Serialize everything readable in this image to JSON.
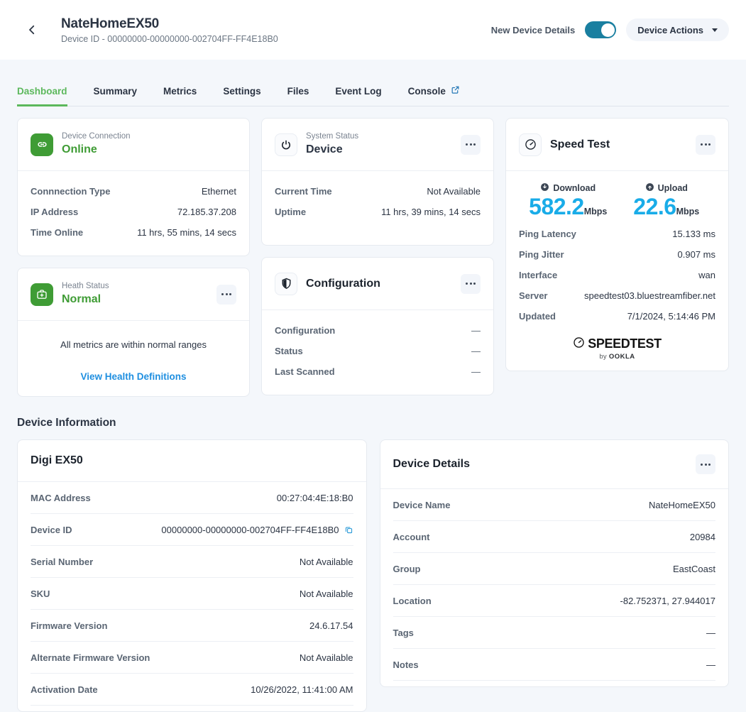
{
  "header": {
    "back_icon": "chevron-left-icon",
    "title": "NateHomeEX50",
    "subtitle": "Device ID - 00000000-00000000-002704FF-FF4E18B0",
    "toggle_label": "New Device Details",
    "toggle_state": "on",
    "toggle_color": "#1a7fa0",
    "actions_button": "Device Actions"
  },
  "tabs": [
    {
      "label": "Dashboard",
      "active": true
    },
    {
      "label": "Summary",
      "active": false
    },
    {
      "label": "Metrics",
      "active": false
    },
    {
      "label": "Settings",
      "active": false
    },
    {
      "label": "Files",
      "active": false
    },
    {
      "label": "Event Log",
      "active": false
    },
    {
      "label": "Console",
      "active": false,
      "icon": "external-link-icon"
    }
  ],
  "accent_colors": {
    "tab_active": "#5cb85c",
    "status_green": "#3f9c35",
    "speed_blue": "#19ace8",
    "link_blue": "#1f8fe0"
  },
  "device_connection": {
    "icon": "link-icon",
    "eyebrow": "Device Connection",
    "status": "Online",
    "rows": [
      {
        "key": "Connnection Type",
        "value": "Ethernet"
      },
      {
        "key": "IP Address",
        "value": "72.185.37.208"
      },
      {
        "key": "Time Online",
        "value": "11 hrs, 55 mins, 14 secs"
      }
    ]
  },
  "health_status": {
    "icon": "first-aid-kit-icon",
    "eyebrow": "Heath Status",
    "status": "Normal",
    "message": "All metrics are within normal ranges",
    "link": "View Health Definitions",
    "menu_icon": "kebab-menu-icon"
  },
  "system_status": {
    "icon": "power-cycle-icon",
    "eyebrow": "System Status",
    "status": "Device",
    "menu_icon": "kebab-menu-icon",
    "rows": [
      {
        "key": "Current Time",
        "value": "Not Available"
      },
      {
        "key": "Uptime",
        "value": "11 hrs, 39 mins, 14 secs"
      }
    ]
  },
  "configuration": {
    "icon": "shield-icon",
    "title": "Configuration",
    "menu_icon": "kebab-menu-icon",
    "rows": [
      {
        "key": "Configuration",
        "value": "—"
      },
      {
        "key": "Status",
        "value": "—"
      },
      {
        "key": "Last Scanned",
        "value": "—"
      }
    ]
  },
  "speed_test": {
    "icon": "speedometer-icon",
    "title": "Speed Test",
    "menu_icon": "kebab-menu-icon",
    "download": {
      "icon": "download-circle-icon",
      "label": "Download",
      "value": "582.2",
      "unit": "Mbps"
    },
    "upload": {
      "icon": "upload-circle-icon",
      "label": "Upload",
      "value": "22.6",
      "unit": "Mbps"
    },
    "rows": [
      {
        "key": "Ping Latency",
        "value": "15.133 ms"
      },
      {
        "key": "Ping Jitter",
        "value": "0.907 ms"
      },
      {
        "key": "Interface",
        "value": "wan"
      },
      {
        "key": "Server",
        "value": "speedtest03.bluestreamfiber.net"
      },
      {
        "key": "Updated",
        "value": "7/1/2024, 5:14:46 PM"
      }
    ],
    "logo": {
      "wordmark": "SPEEDTEST",
      "by": "by",
      "brand": "OOKLA"
    }
  },
  "device_information": {
    "section_title": "Device Information",
    "left_panel": {
      "title": "Digi EX50",
      "rows": [
        {
          "key": "MAC Address",
          "value": "00:27:04:4E:18:B0"
        },
        {
          "key": "Device ID",
          "value": "00000000-00000000-002704FF-FF4E18B0",
          "copy": true
        },
        {
          "key": "Serial Number",
          "value": "Not Available"
        },
        {
          "key": "SKU",
          "value": "Not Available"
        },
        {
          "key": "Firmware Version",
          "value": "24.6.17.54"
        },
        {
          "key": "Alternate Firmware Version",
          "value": "Not Available"
        },
        {
          "key": "Activation Date",
          "value": "10/26/2022, 11:41:00 AM"
        }
      ]
    },
    "right_panel": {
      "title": "Device Details",
      "menu_icon": "kebab-menu-icon",
      "rows": [
        {
          "key": "Device Name",
          "value": "NateHomeEX50"
        },
        {
          "key": "Account",
          "value": "20984"
        },
        {
          "key": "Group",
          "value": "EastCoast"
        },
        {
          "key": "Location",
          "value": "-82.752371, 27.944017"
        },
        {
          "key": "Tags",
          "value": "—"
        },
        {
          "key": "Notes",
          "value": "—"
        }
      ]
    }
  }
}
